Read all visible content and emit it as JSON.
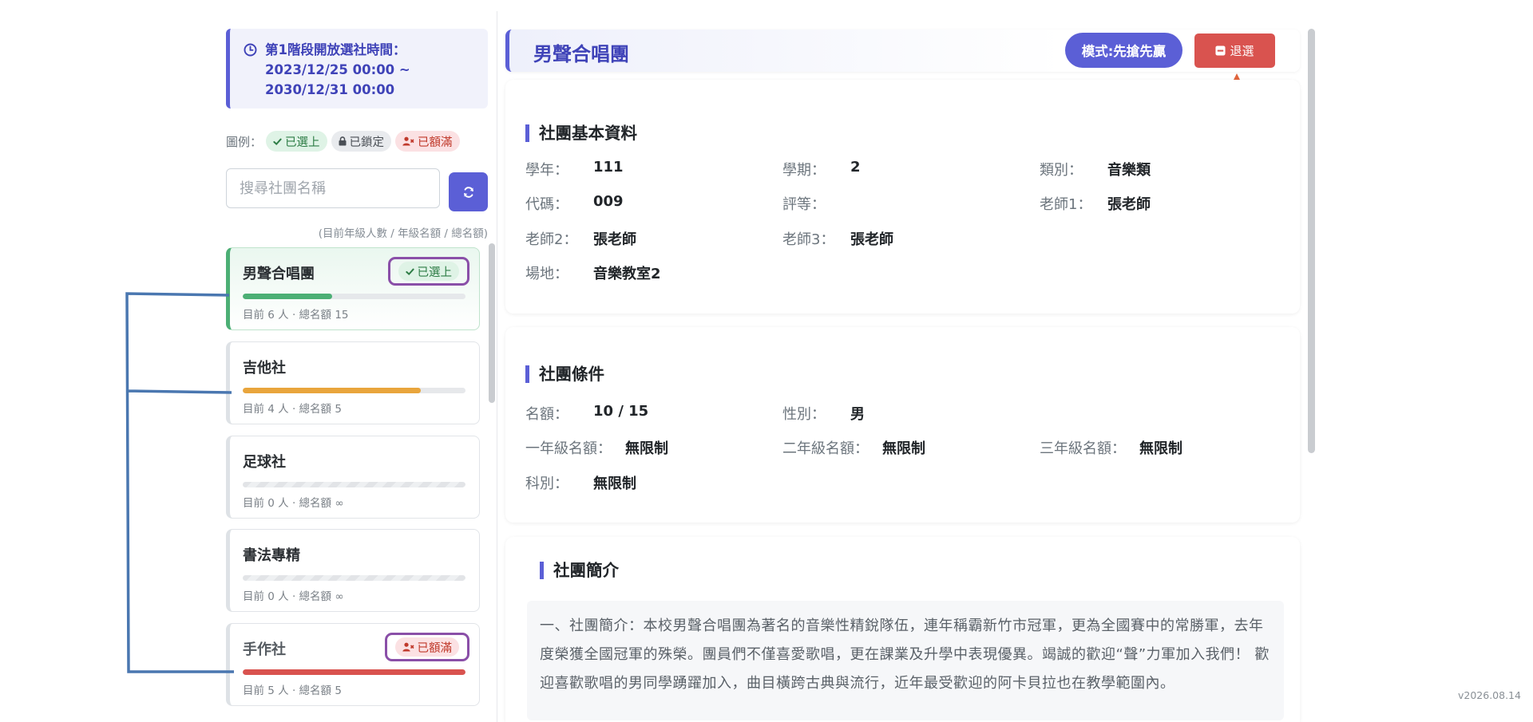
{
  "notice": {
    "text": "第1階段開放選社時間：2023/12/25 00:00 ~ 2030/12/31 00:00"
  },
  "legend": {
    "label": "圖例：",
    "items": [
      {
        "label": "已選上",
        "icon": "check-icon",
        "color": "#2e7d46"
      },
      {
        "label": "已鎖定",
        "icon": "lock-icon",
        "color": "#4a4f55"
      },
      {
        "label": "已額滿",
        "icon": "user-x-icon",
        "color": "#c0392b"
      }
    ]
  },
  "search": {
    "placeholder": "搜尋社團名稱",
    "value": ""
  },
  "list_hint": "(目前年級人數 / 年級名額 / 總名額)",
  "clubs": [
    {
      "name": "男聲合唱團",
      "meta": "目前 6 人 · 總名額 15",
      "progress": 0.4,
      "bar_color": "#4caf75",
      "status": "已選上"
    },
    {
      "name": "吉他社",
      "meta": "目前 4 人 · 總名額 5",
      "progress": 0.8,
      "bar_color": "#e9a53c",
      "status": ""
    },
    {
      "name": "足球社",
      "meta": "目前 0 人 · 總名額 ∞",
      "progress": 0,
      "bar_color": "",
      "status": ""
    },
    {
      "name": "書法專精",
      "meta": "目前 0 人 · 總名額 ∞",
      "progress": 0,
      "bar_color": "",
      "status": ""
    },
    {
      "name": "手作社",
      "meta": "目前 5 人 · 總名額 5",
      "progress": 1.0,
      "bar_color": "#d9534f",
      "status": "已額滿"
    }
  ],
  "detail": {
    "title": "男聲合唱團",
    "mode": "模式:先搶先贏",
    "withdraw": "退選",
    "basic": {
      "title": "社團基本資料",
      "year_label": "學年：",
      "year": "111",
      "term_label": "學期：",
      "term": "2",
      "category_label": "類別：",
      "category": "音樂類",
      "code_label": "代碼：",
      "code": "009",
      "rating_label": "評等：",
      "rating": "",
      "teacher1_label": "老師1：",
      "teacher1": "張老師",
      "teacher2_label": "老師2：",
      "teacher2": "張老師",
      "teacher3_label": "老師3：",
      "teacher3": "張老師",
      "venue_label": "場地：",
      "venue": "音樂教室2"
    },
    "conditions": {
      "title": "社團條件",
      "quota_label": "名額：",
      "quota": "10 / 15",
      "gender_label": "性別：",
      "gender": "男",
      "g1_label": "一年級名額：",
      "g1": "無限制",
      "g2_label": "二年級名額：",
      "g2": "無限制",
      "g3_label": "三年級名額：",
      "g3": "無限制",
      "dept_label": "科別：",
      "dept": "無限制"
    },
    "intro": {
      "title": "社團簡介",
      "text": "一、社團簡介：本校男聲合唱團為著名的音樂性精銳隊伍，連年稱霸新竹市冠軍，更為全國賽中的常勝軍，去年度榮獲全國冠軍的殊榮。團員們不僅喜愛歌唱，更在課業及升學中表現優異。竭誠的歡迎“聲”力軍加入我們！ 歡迎喜歡歌唱的男同學踴躍加入，曲目橫跨古典與流行，近年最受歡迎的阿卡貝拉也在教學範圍內。"
    }
  },
  "version": "v2026.08.14",
  "colors": {
    "primary": "#5b5fd6",
    "danger": "#d9534f",
    "success": "#4caf75",
    "warning": "#e9a53c",
    "annotation_blue": "#4a77b0",
    "annotation_orange": "#e0643c",
    "annotation_purple": "#8a4fa8"
  }
}
